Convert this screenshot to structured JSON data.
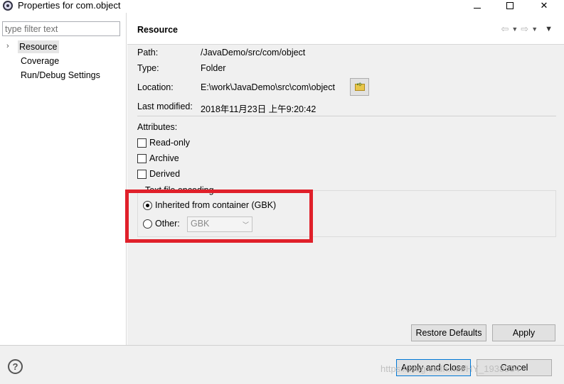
{
  "window": {
    "title": "Properties for com.object"
  },
  "left": {
    "filter_placeholder": "type filter text",
    "tree_items": [
      "Resource",
      "Coverage",
      "Run/Debug Settings"
    ]
  },
  "page": {
    "title": "Resource",
    "fields": {
      "path_label": "Path:",
      "path_value": "/JavaDemo/src/com/object",
      "type_label": "Type:",
      "type_value": "Folder",
      "location_label": "Location:",
      "location_value": "E:\\work\\JavaDemo\\src\\com\\object",
      "modified_label": "Last modified:",
      "modified_value": "2018年11月23日 上午9:20:42"
    },
    "attributes": {
      "label": "Attributes:",
      "read_only": "Read-only",
      "archive": "Archive",
      "derived": "Derived"
    },
    "encoding": {
      "legend": "Text file encoding",
      "inherited": "Inherited from container (GBK)",
      "other": "Other:",
      "other_value": "GBK"
    },
    "buttons": {
      "restore": "Restore Defaults",
      "apply": "Apply"
    }
  },
  "footer": {
    "help": "?",
    "apply_close": "Apply and Close",
    "cancel": "Cancel",
    "watermark": "https://blog.csdn.net/HY_1938534"
  },
  "colors": {
    "highlight": "#e0202a"
  }
}
